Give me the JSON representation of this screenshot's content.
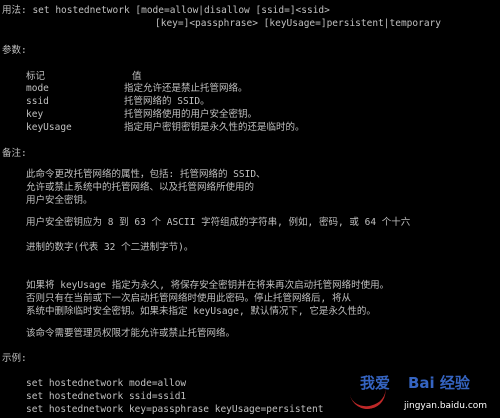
{
  "console": {
    "usage_line1": "用法: set hostednetwork [mode=allow|disallow [ssid=]<ssid>",
    "usage_line2": "[key=]<passphrase> [keyUsage=]persistent|temporary",
    "params_heading": "参数:",
    "table_tag": "标记",
    "table_value": "值",
    "params": [
      {
        "tag": "mode",
        "desc": "指定允许还是禁止托管网络。"
      },
      {
        "tag": "ssid",
        "desc": "托管网络的 SSID。"
      },
      {
        "tag": "key",
        "desc": "托管网络使用的用户安全密钥。"
      },
      {
        "tag": "keyUsage",
        "desc": "指定用户密钥密钥是永久性的还是临时的。"
      }
    ],
    "notes_heading": "备注:",
    "note_lines": [
      "此命令更改托管网络的属性，包括: 托管网络的 SSID、",
      "允许或禁止系统中的托管网络、以及托管网络所使用的",
      "用户安全密钥。",
      "用户安全密钥应为 8 到 63 个 ASCII 字符组成的字符串, 例如, 密码, 或 64 个十六",
      "进制的数字(代表 32 个二进制字节)。",
      "如果将 keyUsage 指定为永久, 将保存安全密钥并在将来再次启动托管网络时使用。",
      "否则只有在当前或下一次启动托管网络时使用此密码。停止托管网络后, 将从",
      "系统中删除临时安全密钥。如果未指定 keyUsage, 默认情况下, 它是永久性的。",
      "该命令需要管理员权限才能允许或禁止托管网络。"
    ],
    "examples_heading": "示例:",
    "examples": [
      "set hostednetwork mode=allow",
      "set hostednetwork ssid=ssid1",
      "set hostednetwork key=passphrase keyUsage=persistent"
    ]
  },
  "watermark": {
    "text": "我爱",
    "brand": "Bai 经验",
    "url": "jingyan.baidu.com"
  }
}
